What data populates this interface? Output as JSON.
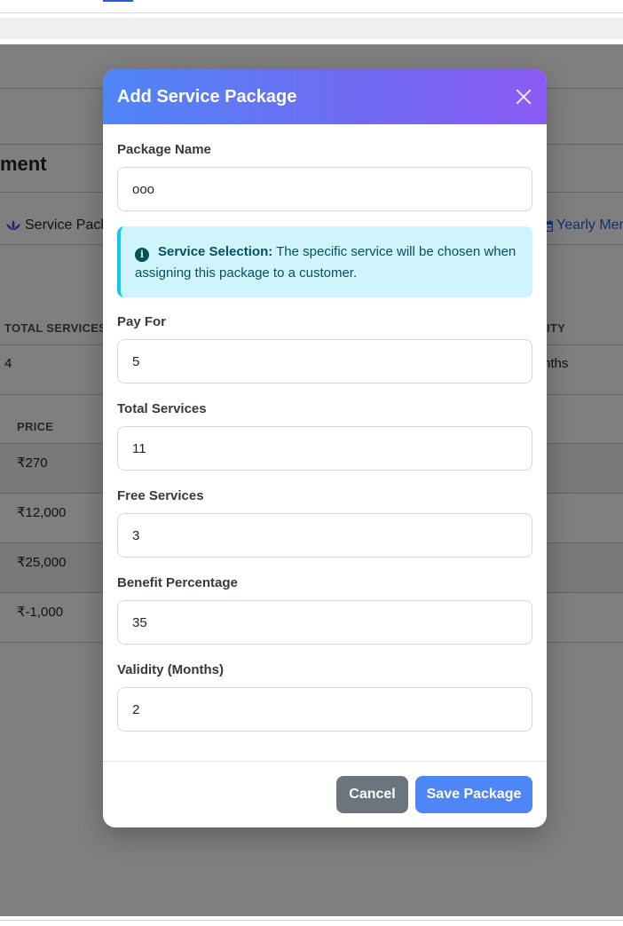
{
  "background": {
    "page_heading": "ment",
    "tabs": [
      {
        "label": "Service Pack"
      },
      {
        "label": "Yearly Mer"
      }
    ],
    "summary_table": {
      "headers": [
        "TOTAL SERVICES",
        "ITY"
      ],
      "row": [
        "4",
        "nths"
      ]
    },
    "price_table": {
      "header": "PRICE",
      "rows": [
        "₹270",
        "₹12,000",
        "₹25,000",
        "₹-1,000"
      ]
    }
  },
  "modal": {
    "title": "Add Service Package",
    "fields": {
      "package_name": {
        "label": "Package Name",
        "value": "ooo"
      },
      "pay_for": {
        "label": "Pay For",
        "value": "5"
      },
      "total_services": {
        "label": "Total Services",
        "value": "11"
      },
      "free_services": {
        "label": "Free Services",
        "value": "3"
      },
      "benefit_percentage": {
        "label": "Benefit Percentage",
        "value": "35"
      },
      "validity_months": {
        "label": "Validity (Months)",
        "value": "2"
      }
    },
    "info": {
      "title": "Service Selection:",
      "text": "The specific service will be chosen when assigning this package to a customer."
    },
    "buttons": {
      "cancel": "Cancel",
      "save": "Save Package"
    }
  },
  "colors": {
    "header_gradient_start": "#4f86f7",
    "header_gradient_end": "#8b5cf6",
    "info_bg": "#cff4fc",
    "info_border": "#0dcaf0",
    "cancel_bg": "#6c757d",
    "save_bg": "#4f86f7"
  },
  "icons": [
    "close-icon",
    "info-icon",
    "lotus-icon",
    "calendar-icon"
  ]
}
